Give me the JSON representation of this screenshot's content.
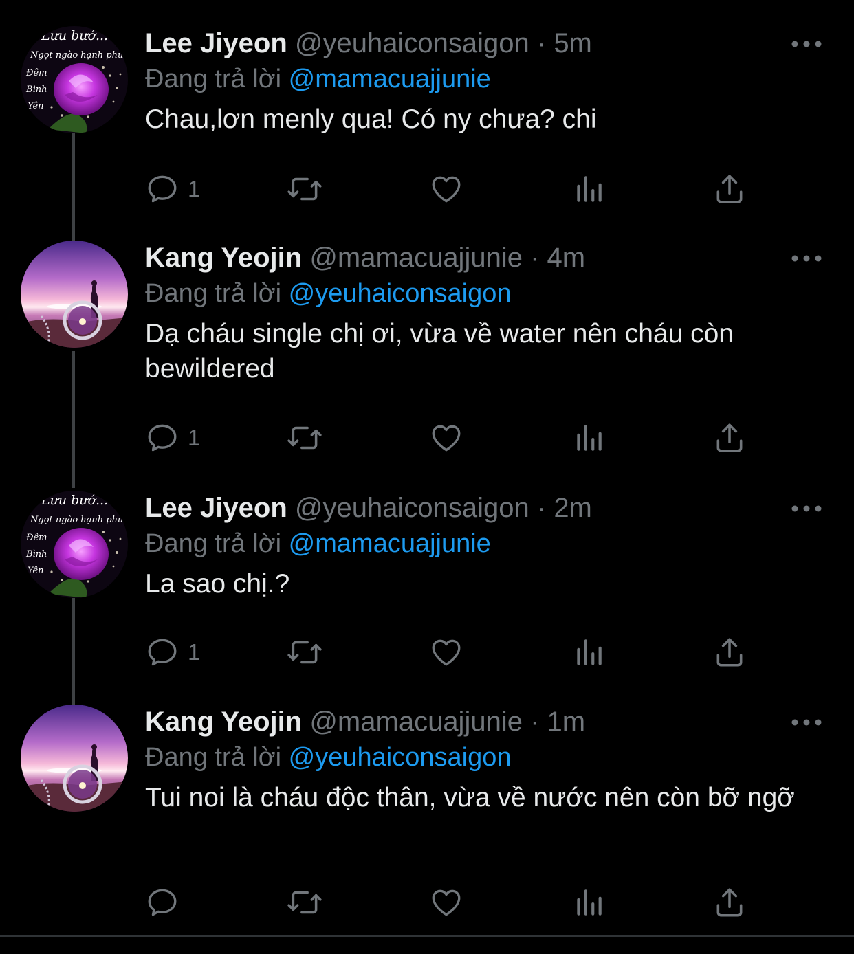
{
  "tweets": [
    {
      "display_name": "Lee Jiyeon",
      "handle": "@yeuhaiconsaigon",
      "separator": "·",
      "time": "5m",
      "reply_label": "Đang trả lời",
      "reply_to": "@mamacuajjunie",
      "text": "Chau,lơn menly qua! Có ny chưa? chi",
      "reply_count": "1",
      "avatar_icon": "purple-rose-avatar-icon"
    },
    {
      "display_name": "Kang Yeojin",
      "handle": "@mamacuajjunie",
      "separator": "·",
      "time": "4m",
      "reply_label": "Đang trả lời",
      "reply_to": "@yeuhaiconsaigon",
      "text": "Dạ cháu single chị ơi, vừa về water nên cháu còn bewildered",
      "reply_count": "1",
      "avatar_icon": "sunset-silhouette-avatar-icon"
    },
    {
      "display_name": "Lee Jiyeon",
      "handle": "@yeuhaiconsaigon",
      "separator": "·",
      "time": "2m",
      "reply_label": "Đang trả lời",
      "reply_to": "@mamacuajjunie",
      "text": "La sao chị.?",
      "reply_count": "1",
      "avatar_icon": "purple-rose-avatar-icon"
    },
    {
      "display_name": "Kang Yeojin",
      "handle": "@mamacuajjunie",
      "separator": "·",
      "time": "1m",
      "reply_label": "Đang trả lời",
      "reply_to": "@yeuhaiconsaigon",
      "text": "Tui noi là cháu độc thân, vừa về nước nên còn bỡ ngỡ",
      "reply_count": "",
      "avatar_icon": "sunset-silhouette-avatar-icon"
    }
  ],
  "rose_avatar_text": {
    "line1": "Lưu bướ...",
    "line2": "Ngọt ngào hạnh phúc",
    "line3": "Đêm",
    "line4": "Bình",
    "line5": "Yên"
  },
  "icons": {
    "reply": "reply-icon",
    "retweet": "retweet-icon",
    "like": "heart-icon",
    "views": "views-icon",
    "share": "share-icon",
    "more": "more-icon"
  },
  "colors": {
    "background": "#000000",
    "primary_text": "#e7e9ea",
    "secondary_text": "#71767b",
    "link": "#1d9bf0",
    "thread_line": "#3e4144"
  }
}
